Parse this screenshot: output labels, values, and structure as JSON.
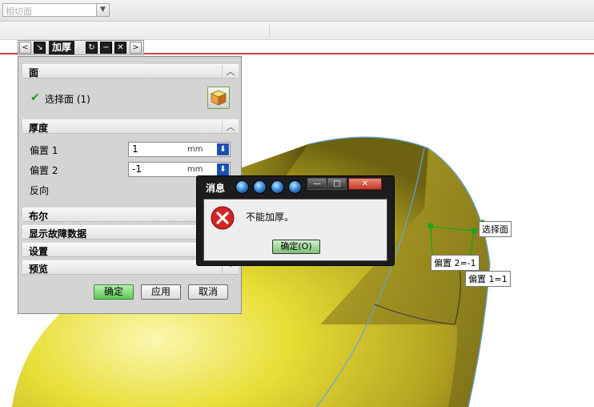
{
  "toolbar": {
    "filter_value": "相切面"
  },
  "thicken_dialog": {
    "title": "加厚",
    "sections": {
      "face": {
        "label": "面",
        "select_face": "选择面 (1)"
      },
      "thickness": {
        "label": "厚度",
        "offset1_label": "偏置 1",
        "offset1_value": "1",
        "offset1_unit": "mm",
        "offset2_label": "偏置 2",
        "offset2_value": "-1",
        "offset2_unit": "mm",
        "reverse_label": "反向"
      },
      "boolean": "布尔",
      "show_failure": "显示故障数据",
      "settings": "设置",
      "preview": "预览"
    },
    "buttons": {
      "ok": "确定",
      "apply": "应用",
      "cancel": "取消"
    }
  },
  "message_box": {
    "title": "消息",
    "text": "不能加厚。",
    "ok": "确定(O)"
  },
  "graphics": {
    "callouts": {
      "select_face": "选择面",
      "offset2": "偏置 2=-1",
      "offset1": "偏置 1=1"
    }
  }
}
